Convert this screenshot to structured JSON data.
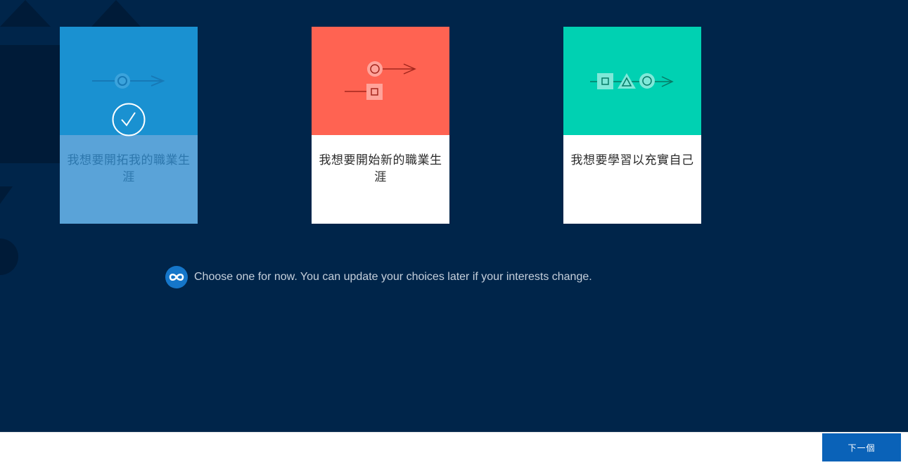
{
  "cards": [
    {
      "label": "我想要開拓我的職業生涯",
      "selected": true,
      "art_icon": "circle-arrow-icon"
    },
    {
      "label": "我想要開始新的職業生涯",
      "selected": false,
      "art_icon": "circle-square-arrows-icon"
    },
    {
      "label": "我想要學習以充實自己",
      "selected": false,
      "art_icon": "square-triangle-circle-arrow-icon"
    }
  ],
  "hint": {
    "icon": "infinity-icon",
    "text": "Choose one for now. You can update your choices later if your interests change."
  },
  "footer": {
    "next_label": "下一個"
  },
  "colors": {
    "background": "#00254a",
    "card_blue": "#1a91d1",
    "card_red": "#ff6352",
    "card_teal": "#00d1b2",
    "button": "#0a62b8"
  }
}
